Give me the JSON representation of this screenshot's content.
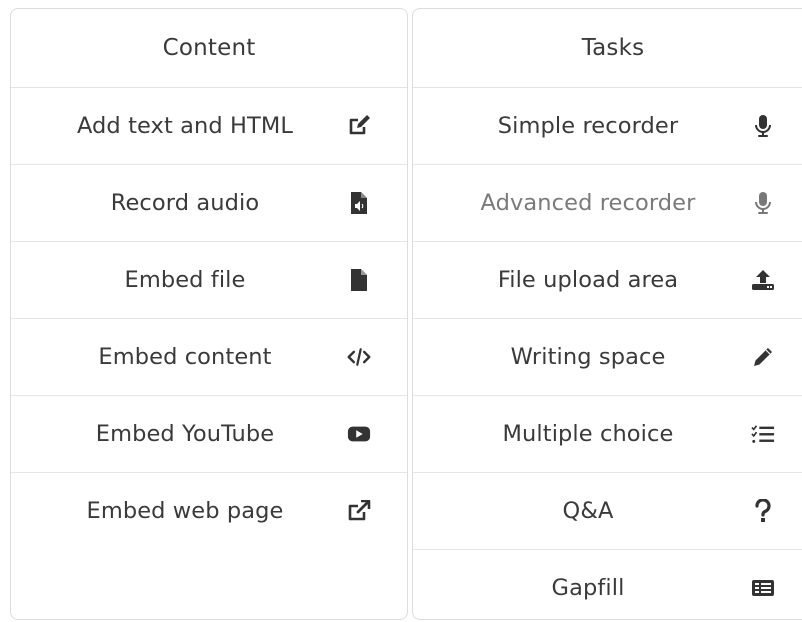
{
  "content_panel": {
    "title": "Content",
    "items": [
      {
        "label": "Add text and HTML",
        "icon": "edit-icon"
      },
      {
        "label": "Record audio",
        "icon": "audio-file-icon"
      },
      {
        "label": "Embed file",
        "icon": "file-icon"
      },
      {
        "label": "Embed content",
        "icon": "code-icon"
      },
      {
        "label": "Embed YouTube",
        "icon": "youtube-icon"
      },
      {
        "label": "Embed web page",
        "icon": "external-link-icon"
      }
    ]
  },
  "tasks_panel": {
    "title": "Tasks",
    "items": [
      {
        "label": "Simple recorder",
        "icon": "microphone-icon"
      },
      {
        "label": "Advanced recorder",
        "icon": "microphone-icon"
      },
      {
        "label": "File upload area",
        "icon": "upload-icon"
      },
      {
        "label": "Writing space",
        "icon": "pencil-icon"
      },
      {
        "label": "Multiple choice",
        "icon": "checklist-icon"
      },
      {
        "label": "Q&A",
        "icon": "question-icon"
      },
      {
        "label": "Gapfill",
        "icon": "list-alt-icon"
      }
    ]
  },
  "colors": {
    "text": "#3a3a3a",
    "muted_text": "#7a7a7a",
    "icon": "#333333",
    "border": "#dcdcdc"
  }
}
